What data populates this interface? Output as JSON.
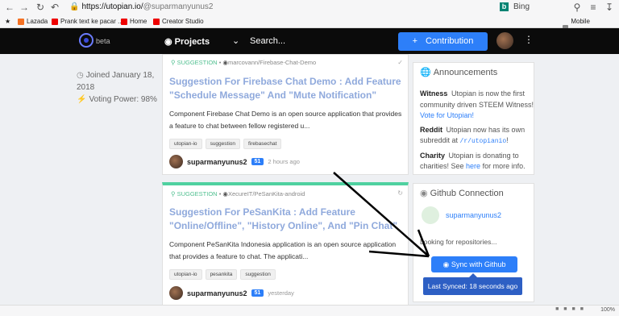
{
  "browser": {
    "url_host": "https://utopian.io/",
    "url_path": "@suparmanyunus2",
    "search_engine": "Bing",
    "bookmarks": [
      {
        "label": "Lazada",
        "color": "#f57224"
      },
      {
        "label": "Prank text ke pacar ...",
        "color": "#e00"
      },
      {
        "label": "Home",
        "color": "#e00"
      },
      {
        "label": "Creator Studio",
        "color": "#e00"
      }
    ],
    "mobile_bookmarks": "Mobile bookmarks",
    "zoom": "100%"
  },
  "nav": {
    "logo_text": "beta",
    "projects_label": "Projects",
    "search_label": "Search...",
    "contribution_label": "Contribution"
  },
  "profile": {
    "joined": "Joined January 18, 2018",
    "voting_power": "Voting Power: 98%"
  },
  "cards": [
    {
      "category": "SUGGESTION",
      "repo": "marcovann/Firebase-Chat-Demo",
      "title": "Suggestion For Firebase Chat Demo : Add Feature \"Schedule Message\" And \"Mute Notification\"",
      "description": "Component Firebase Chat Demo is an open source application that provides a feature to chat between fellow registered u...",
      "tags": [
        "utopian-io",
        "suggestion",
        "firebasechat"
      ],
      "author": "suparmanyunus2",
      "reputation": "51",
      "time": "2 hours ago"
    },
    {
      "category": "SUGGESTION",
      "repo": "XecureIT/PeSanKita-android",
      "title": "Suggestion For PeSanKita : Add Feature \"Online/Offline\", \"History Online\", And \"Pin Chat\"",
      "description": "Component PeSanKita Indonesia application is an open source application that provides a feature to chat. The applicati...",
      "tags": [
        "utopian-io",
        "pesankita",
        "suggestion"
      ],
      "author": "suparmanyunus2",
      "reputation": "51",
      "time": "yesterday"
    }
  ],
  "announcements": {
    "title": "Announcements",
    "items": [
      {
        "label": "Witness",
        "text": "Utopian is now the first community driven STEEM Witness!",
        "link": "Vote for Utopian!"
      },
      {
        "label": "Reddit",
        "text": "Utopian now has its own subreddit at",
        "code": "/r/utopianio",
        "suffix": "!"
      },
      {
        "label": "Charity",
        "text": "Utopian is donating to charities! See",
        "link": "here",
        "suffix": " for more info."
      }
    ]
  },
  "github": {
    "title": "Github Connection",
    "username": "suparmanyunus2",
    "status": "Looking for repositories...",
    "sync_label": "Sync with Github",
    "last_synced": "Last Synced: 18 seconds ago"
  }
}
